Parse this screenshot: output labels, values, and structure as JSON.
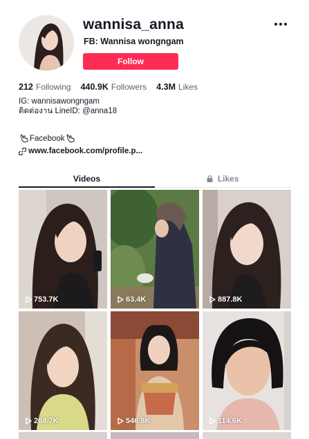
{
  "profile": {
    "username": "wannisa_anna",
    "fullname": "FB: Wannisa wongngam",
    "follow_label": "Follow"
  },
  "stats": [
    {
      "num": "212",
      "label": "Following"
    },
    {
      "num": "440.9K",
      "label": "Followers"
    },
    {
      "num": "4.3M",
      "label": "Likes"
    }
  ],
  "bio": {
    "line1": "IG: wannisawongngam",
    "line2": "ติดต่องาน LineID: @anna18",
    "facebook_label": "Facebook",
    "link": "www.facebook.com/profile.p..."
  },
  "icons": {
    "more": "more-icon",
    "hand": "pointing-hand-icon",
    "link": "link-icon",
    "lock": "lock-icon",
    "play": "play-icon"
  },
  "tabs": [
    {
      "label": "Videos",
      "active": true
    },
    {
      "label": "Likes",
      "active": false
    }
  ],
  "videos": [
    {
      "views": "753.7K"
    },
    {
      "views": "63.4K"
    },
    {
      "views": "887.8K"
    },
    {
      "views": "264.7K"
    },
    {
      "views": "546.8K"
    },
    {
      "views": "114.6K"
    }
  ],
  "colors": {
    "accent": "#fe2c55",
    "text": "#161823",
    "muted": "#8a8b91"
  }
}
